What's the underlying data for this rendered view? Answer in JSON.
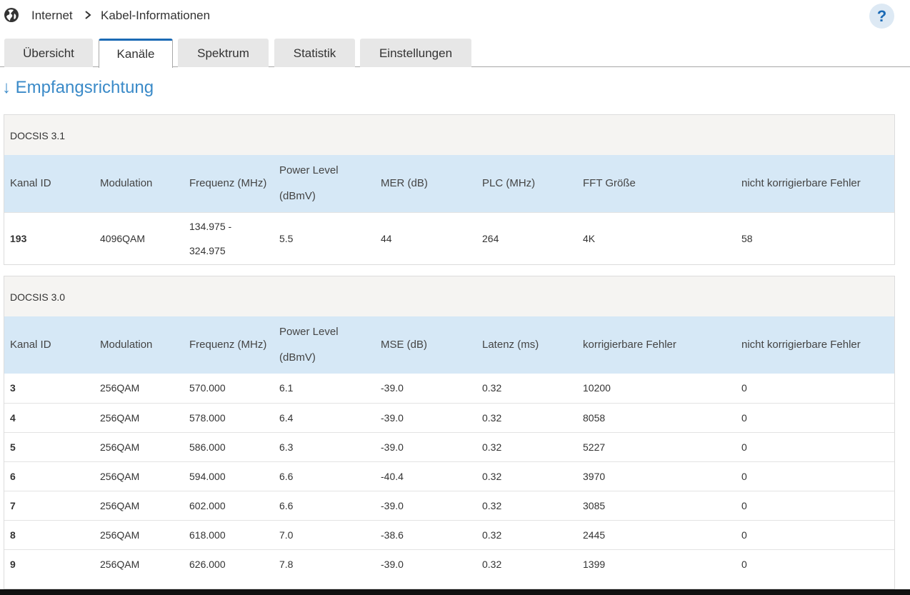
{
  "breadcrumb": {
    "root": "Internet",
    "current": "Kabel-Informationen"
  },
  "help": {
    "label": "?"
  },
  "tabs": [
    {
      "label": "Übersicht",
      "active": false
    },
    {
      "label": "Kanäle",
      "active": true
    },
    {
      "label": "Spektrum",
      "active": false
    },
    {
      "label": "Statistik",
      "active": false
    },
    {
      "label": "Einstellungen",
      "active": false
    }
  ],
  "section": {
    "arrow": "↓",
    "title": "Empfangsrichtung"
  },
  "docsis31": {
    "title": "DOCSIS 3.1",
    "headers": {
      "kanal_id": "Kanal ID",
      "modulation": "Modulation",
      "frequenz": "Frequenz (MHz)",
      "power_l1": "Power Level",
      "power_l2": "(dBmV)",
      "mer": "MER (dB)",
      "plc": "PLC (MHz)",
      "fft": "FFT Größe",
      "nkf": "nicht korrigierbare Fehler"
    },
    "rows": [
      {
        "kanal_id": "193",
        "modulation": "4096QAM",
        "freq_l1": "134.975 -",
        "freq_l2": "324.975",
        "power": "5.5",
        "mer": "44",
        "plc": "264",
        "fft": "4K",
        "nkf": "58"
      }
    ]
  },
  "docsis30": {
    "title": "DOCSIS 3.0",
    "headers": {
      "kanal_id": "Kanal ID",
      "modulation": "Modulation",
      "frequenz": "Frequenz (MHz)",
      "power_l1": "Power Level",
      "power_l2": "(dBmV)",
      "mse": "MSE (dB)",
      "latenz": "Latenz (ms)",
      "kf": "korrigierbare Fehler",
      "nkf": "nicht korrigierbare Fehler"
    },
    "rows": [
      {
        "kanal_id": "3",
        "modulation": "256QAM",
        "frequenz": "570.000",
        "power": "6.1",
        "mse": "-39.0",
        "latenz": "0.32",
        "kf": "10200",
        "nkf": "0"
      },
      {
        "kanal_id": "4",
        "modulation": "256QAM",
        "frequenz": "578.000",
        "power": "6.4",
        "mse": "-39.0",
        "latenz": "0.32",
        "kf": "8058",
        "nkf": "0"
      },
      {
        "kanal_id": "5",
        "modulation": "256QAM",
        "frequenz": "586.000",
        "power": "6.3",
        "mse": "-39.0",
        "latenz": "0.32",
        "kf": "5227",
        "nkf": "0"
      },
      {
        "kanal_id": "6",
        "modulation": "256QAM",
        "frequenz": "594.000",
        "power": "6.6",
        "mse": "-40.4",
        "latenz": "0.32",
        "kf": "3970",
        "nkf": "0"
      },
      {
        "kanal_id": "7",
        "modulation": "256QAM",
        "frequenz": "602.000",
        "power": "6.6",
        "mse": "-39.0",
        "latenz": "0.32",
        "kf": "3085",
        "nkf": "0"
      },
      {
        "kanal_id": "8",
        "modulation": "256QAM",
        "frequenz": "618.000",
        "power": "7.0",
        "mse": "-38.6",
        "latenz": "0.32",
        "kf": "2445",
        "nkf": "0"
      },
      {
        "kanal_id": "9",
        "modulation": "256QAM",
        "frequenz": "626.000",
        "power": "7.8",
        "mse": "-39.0",
        "latenz": "0.32",
        "kf": "1399",
        "nkf": "0"
      }
    ]
  }
}
